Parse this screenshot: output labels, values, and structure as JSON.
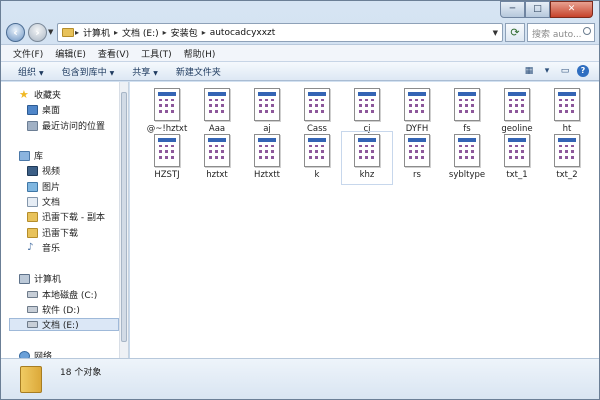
{
  "window": {
    "controls": {
      "minimize": "─",
      "maximize": "□",
      "close": "✕"
    }
  },
  "address": {
    "crumbs": [
      "计算机",
      "文档 (E:)",
      "安装包",
      "autocadcyxxzt"
    ],
    "separator": "▸"
  },
  "search": {
    "placeholder": "搜索 auto..."
  },
  "menubar": {
    "items": [
      "文件(F)",
      "编辑(E)",
      "查看(V)",
      "工具(T)",
      "帮助(H)"
    ]
  },
  "cmdbar": {
    "organize": "组织",
    "include_library": "包含到库中",
    "share": "共享",
    "new_folder": "新建文件夹"
  },
  "nav": {
    "favorites": "收藏夹",
    "desktop": "桌面",
    "recent": "最近访问的位置",
    "library": "库",
    "video": "视频",
    "pictures": "图片",
    "documents": "文档",
    "xunlei_copy": "迅雷下载 - 副本",
    "xunlei": "迅雷下载",
    "music": "音乐",
    "computer": "计算机",
    "local_disk": "本地磁盘 (C:)",
    "software": "软件 (D:)",
    "docs_drive": "文档 (E:)",
    "network": "网络"
  },
  "files": [
    "@~!hztxt",
    "Aaa",
    "aj",
    "Cass",
    "cj",
    "DYFH",
    "fs",
    "geoline",
    "ht",
    "HZSTJ",
    "hztxt",
    "Hztxtt",
    "k",
    "khz",
    "rs",
    "sybltype",
    "txt_1",
    "txt_2"
  ],
  "selected_file": "khz",
  "status": {
    "count_text": "18 个对象"
  },
  "colors": {
    "accent": "#3464b4",
    "window_chrome": "#c4d6ea"
  }
}
